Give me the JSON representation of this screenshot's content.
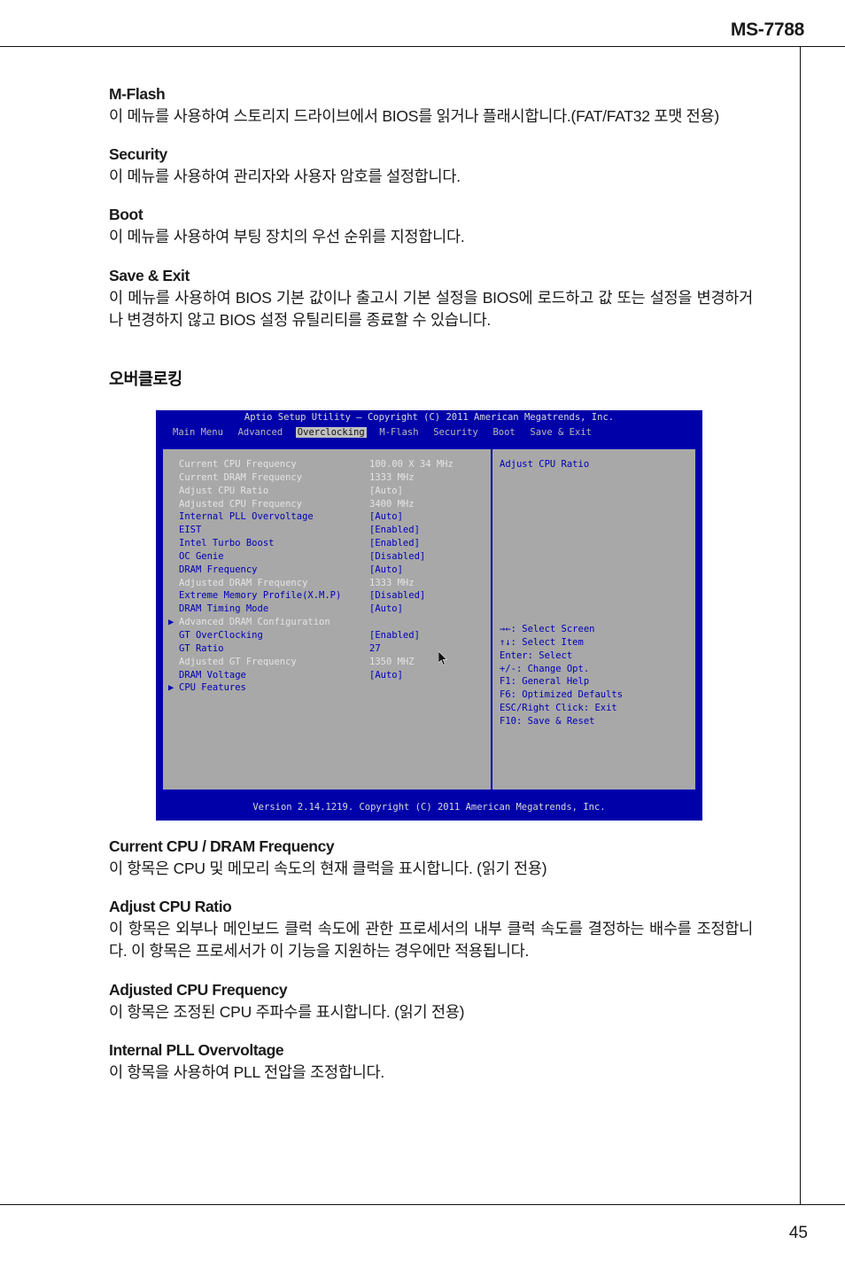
{
  "page": {
    "header_title": "MS-7788",
    "page_number": "45"
  },
  "sections_top": [
    {
      "title": "M-Flash",
      "body": "이 메뉴를 사용하여 스토리지 드라이브에서 BIOS를 읽거나 플래시합니다.(FAT/FAT32 포맷 전용)"
    },
    {
      "title": "Security",
      "body": "이 메뉴를 사용하여 관리자와 사용자 암호를 설정합니다."
    },
    {
      "title": "Boot",
      "body": "이 메뉴를 사용하여 부팅 장치의 우선 순위를 지정합니다."
    },
    {
      "title": "Save & Exit",
      "body": "이 메뉴를 사용하여 BIOS 기본 값이나 출고시 기본 설정을 BIOS에 로드하고 값 또는 설정을 변경하거나 변경하지 않고 BIOS 설정 유틸리티를 종료할 수 있습니다."
    }
  ],
  "kor_heading": "오버클로킹",
  "bios": {
    "title": "Aptio Setup Utility – Copyright (C) 2011 American Megatrends, Inc.",
    "tabs": [
      {
        "label": "Main Menu",
        "active": false
      },
      {
        "label": "Advanced",
        "active": false
      },
      {
        "label": "Overclocking",
        "active": true
      },
      {
        "label": "M-Flash",
        "active": false
      },
      {
        "label": "Security",
        "active": false
      },
      {
        "label": "Boot",
        "active": false
      },
      {
        "label": "Save & Exit",
        "active": false
      }
    ],
    "items": [
      {
        "label": "Current CPU Frequency",
        "value": "100.00 X 34 MHz",
        "style": "ro",
        "arrow": false
      },
      {
        "label": "Current DRAM Frequency",
        "value": "1333 MHz",
        "style": "ro",
        "arrow": false
      },
      {
        "label": "Adjust CPU Ratio",
        "value": "[Auto]",
        "style": "ro",
        "arrow": false
      },
      {
        "label": "Adjusted CPU Frequency",
        "value": "3400 MHz",
        "style": "ro",
        "arrow": false
      },
      {
        "label": "Internal PLL Overvoltage",
        "value": "[Auto]",
        "style": "ed",
        "arrow": false
      },
      {
        "label": "EIST",
        "value": "[Enabled]",
        "style": "ed",
        "arrow": false
      },
      {
        "label": "Intel Turbo Boost",
        "value": "[Enabled]",
        "style": "ed",
        "arrow": false
      },
      {
        "label": "OC Genie",
        "value": "[Disabled]",
        "style": "ed",
        "arrow": false
      },
      {
        "label": "DRAM Frequency",
        "value": "[Auto]",
        "style": "ed",
        "arrow": false
      },
      {
        "label": "Adjusted DRAM Frequency",
        "value": "1333 MHz",
        "style": "ro",
        "arrow": false
      },
      {
        "label": "Extreme Memory Profile(X.M.P)",
        "value": "[Disabled]",
        "style": "ed",
        "arrow": false
      },
      {
        "label": "DRAM Timing Mode",
        "value": "[Auto]",
        "style": "ed",
        "arrow": false
      },
      {
        "label": "Advanced DRAM Configuration",
        "value": "",
        "style": "ro",
        "arrow": true
      },
      {
        "label": "GT OverClocking",
        "value": "[Enabled]",
        "style": "ed",
        "arrow": false
      },
      {
        "label": "GT Ratio",
        "value": "27",
        "style": "ed",
        "arrow": false
      },
      {
        "label": "Adjusted GT Frequency",
        "value": "1350 MHZ",
        "style": "ro",
        "arrow": false
      },
      {
        "label": "DRAM Voltage",
        "value": "[Auto]",
        "style": "ed",
        "arrow": false
      },
      {
        "label": "CPU Features",
        "value": "",
        "style": "ed",
        "arrow": true
      }
    ],
    "help_title": "Adjust CPU Ratio",
    "help_keys": [
      "→←: Select Screen",
      "↑↓: Select Item",
      "Enter: Select",
      "+/-: Change Opt.",
      "F1: General Help",
      "F6: Optimized Defaults",
      "ESC/Right Click: Exit",
      "F10: Save & Reset"
    ],
    "version": "Version 2.14.1219. Copyright (C) 2011 American Megatrends, Inc.",
    "colors": {
      "title_bar": "#0000a8",
      "panel_bg": "#a8a8a8",
      "panel_border": "#0000b4",
      "editable_text": "#0000b4",
      "readonly_text": "#e4e4e4",
      "active_tab_bg": "#c0c0c0"
    }
  },
  "sections_bottom": [
    {
      "title": "Current CPU / DRAM Frequency",
      "body": "이 항목은 CPU 및 메모리 속도의 현재 클럭을 표시합니다. (읽기 전용)"
    },
    {
      "title": "Adjust CPU Ratio",
      "body": "이 항목은 외부나 메인보드 클럭 속도에 관한 프로세서의 내부 클럭 속도를 결정하는 배수를 조정합니다. 이 항목은 프로세서가 이 기능을 지원하는 경우에만 적용됩니다."
    },
    {
      "title": "Adjusted CPU Frequency",
      "body": "이 항목은 조정된 CPU 주파수를 표시합니다. (읽기 전용)"
    },
    {
      "title": "Internal PLL Overvoltage",
      "body": "이 항목을 사용하여 PLL 전압을 조정합니다."
    }
  ]
}
